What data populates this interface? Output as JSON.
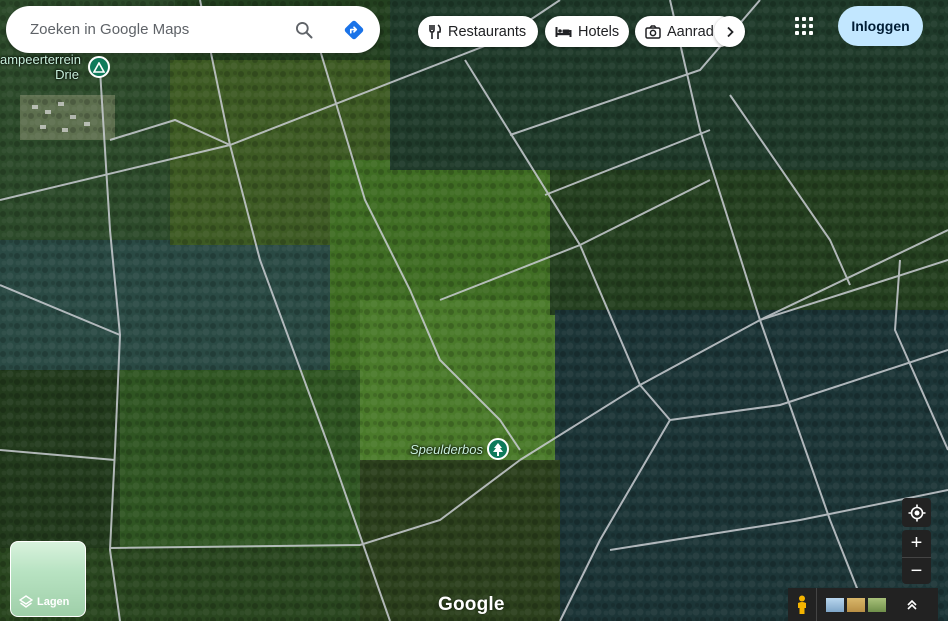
{
  "search": {
    "placeholder": "Zoeken in Google Maps",
    "icon": "search-icon",
    "directions_icon": "directions-icon"
  },
  "chips": [
    {
      "label": "Restaurants",
      "icon": "restaurant-icon"
    },
    {
      "label": "Hotels",
      "icon": "hotel-icon"
    },
    {
      "label": "Aanraders",
      "icon": "camera-icon"
    }
  ],
  "chips_more_icon": "chevron-right-icon",
  "header": {
    "apps_icon": "apps-grid-icon",
    "signin_label": "Inloggen"
  },
  "pois": [
    {
      "label": "ampeerterrein Drie",
      "label_line1": "ampeerterrein",
      "label_line2": "Drie",
      "icon": "campground-icon"
    },
    {
      "label": "Speulderbos",
      "icon": "forest-icon"
    }
  ],
  "controls": {
    "locate_icon": "my-location-icon",
    "zoom_in": "+",
    "zoom_out": "−"
  },
  "layers": {
    "label": "Lagen",
    "icon": "layers-icon"
  },
  "logo": "Google",
  "colors": {
    "accent": "#c2e7ff",
    "poi": "#0f7a5a",
    "directions": "#1a73e8"
  }
}
